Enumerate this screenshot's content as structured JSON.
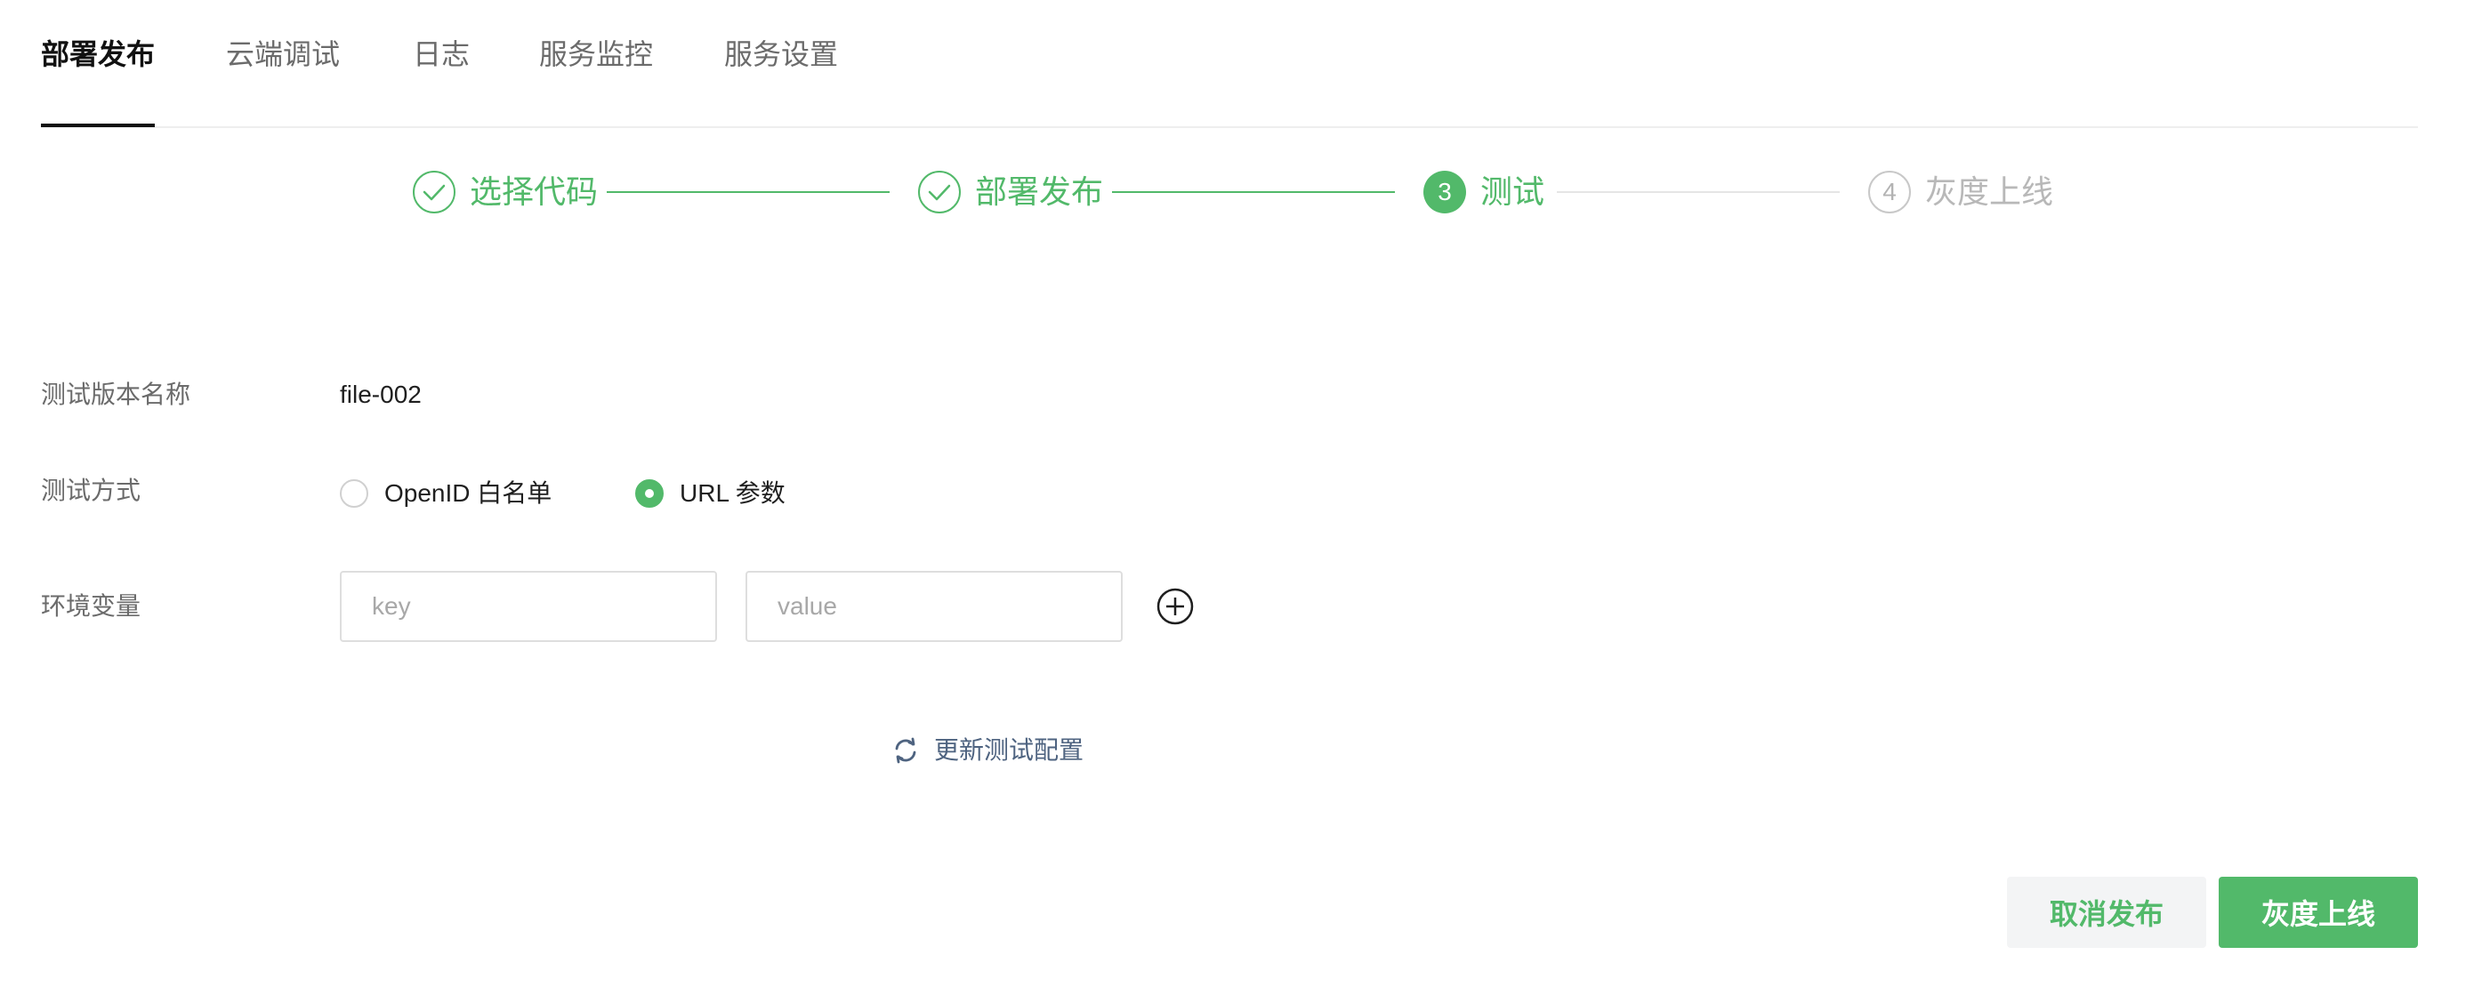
{
  "tabs": [
    {
      "label": "部署发布",
      "active": true
    },
    {
      "label": "云端调试",
      "active": false
    },
    {
      "label": "日志",
      "active": false
    },
    {
      "label": "服务监控",
      "active": false
    },
    {
      "label": "服务设置",
      "active": false
    }
  ],
  "steps": [
    {
      "number": "1",
      "label": "选择代码",
      "state": "done"
    },
    {
      "number": "2",
      "label": "部署发布",
      "state": "done"
    },
    {
      "number": "3",
      "label": "测试",
      "state": "current"
    },
    {
      "number": "4",
      "label": "灰度上线",
      "state": "todo"
    }
  ],
  "form": {
    "version_name_label": "测试版本名称",
    "version_name_value": "file-002",
    "test_method_label": "测试方式",
    "test_method_options": [
      {
        "label": "OpenID 白名单",
        "checked": false
      },
      {
        "label": "URL 参数",
        "checked": true
      }
    ],
    "env_label": "环境变量",
    "key_placeholder": "key",
    "value_placeholder": "value",
    "refresh_label": "更新测试配置"
  },
  "actions": {
    "cancel_label": "取消发布",
    "primary_label": "灰度上线"
  },
  "colors": {
    "accent": "#52b96a",
    "link": "#4e6380"
  }
}
